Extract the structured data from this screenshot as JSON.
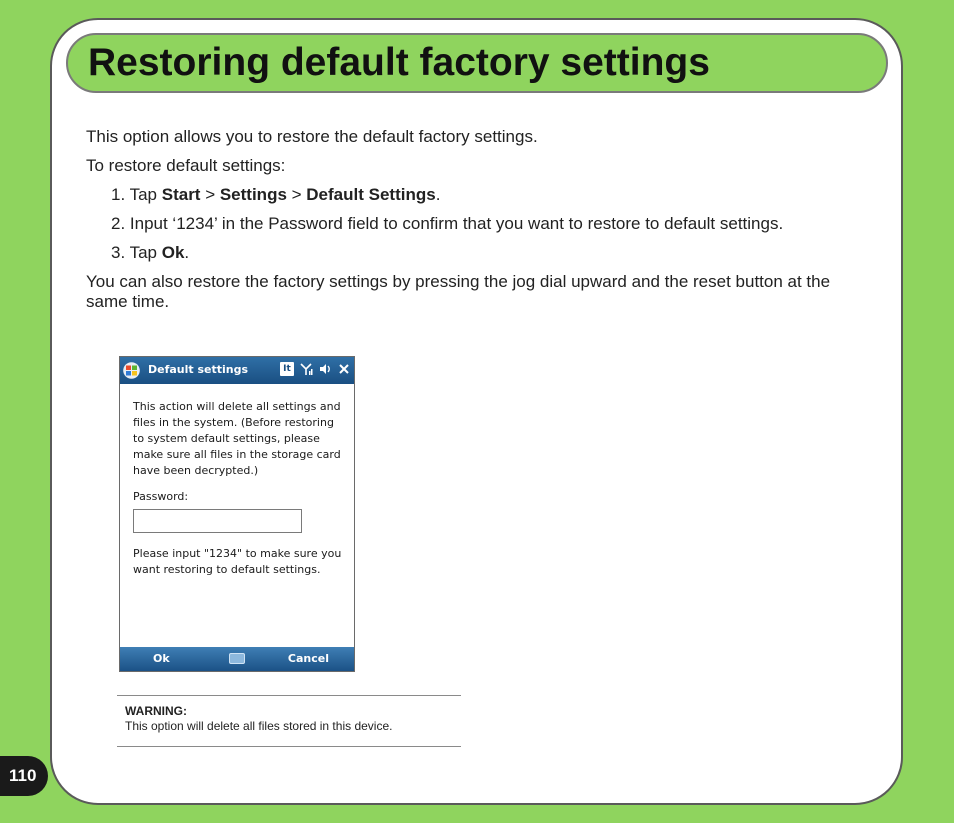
{
  "title": "Restoring default factory settings",
  "intro": "This option allows you to restore the default factory settings.",
  "lead": "To restore default settings:",
  "steps": {
    "s1": {
      "prefix": "1. Tap ",
      "start": "Start",
      "sep1": " > ",
      "settings": "Settings",
      "sep2": " > ",
      "default_settings": "Default Settings",
      "end": "."
    },
    "s2": {
      "text": "2. Input ‘1234’ in the Password field to confirm that you want to restore to default settings."
    },
    "s3": {
      "prefix": "3.  Tap ",
      "ok": "Ok",
      "end": "."
    }
  },
  "also": "You can also restore the factory settings by pressing the jog dial upward and the reset button at the same time.",
  "device": {
    "title": "Default settings",
    "message": "This action will delete all settings and files in the system. (Before restoring to system default settings, please make sure all files in the storage card have been decrypted.)",
    "password_label": "Password:",
    "password_value": "",
    "hint": "Please input \"1234\" to make sure you want restoring to default settings.",
    "softkey_left": "Ok",
    "softkey_right": "Cancel",
    "kb_badge": "It",
    "icons": [
      "windows-flag-icon",
      "keyboard-indicator-icon",
      "signal-icon",
      "speaker-icon",
      "close-icon"
    ]
  },
  "warning": {
    "title": "WARNING:",
    "text": "This option will delete all files stored in this device."
  },
  "page_number": "110",
  "colors": {
    "background": "#8fd45e",
    "title_bar": "#8fd45e",
    "device_bar": "#1a4f82"
  }
}
